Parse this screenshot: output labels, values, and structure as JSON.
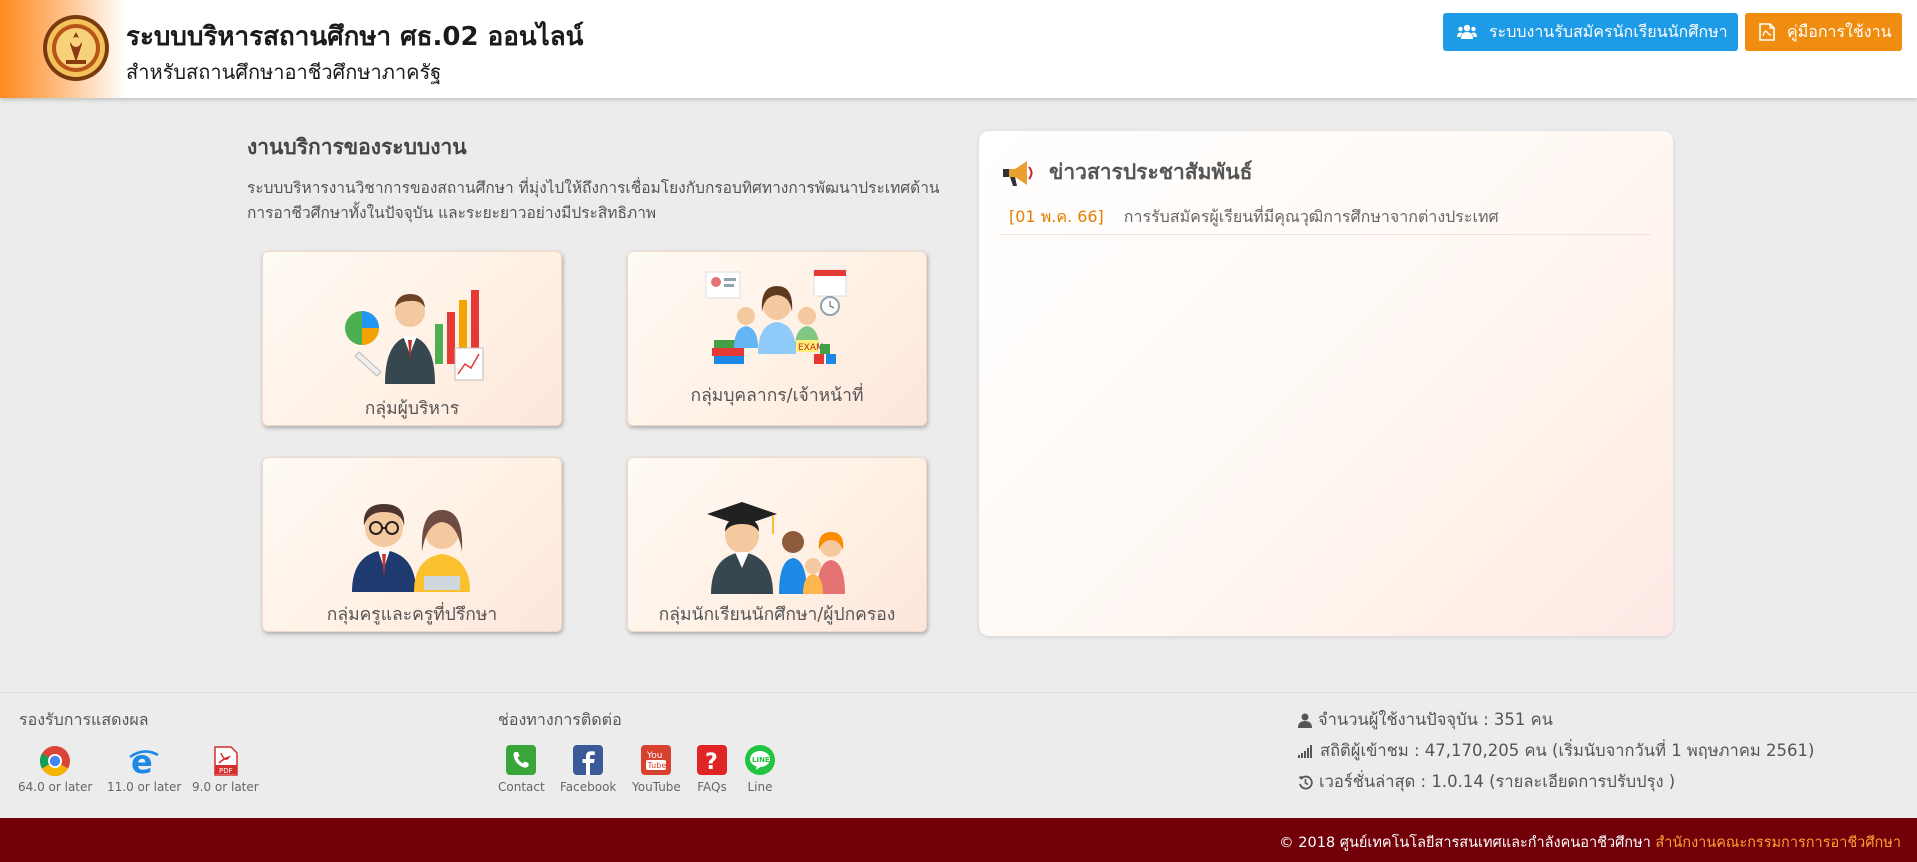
{
  "header": {
    "title": "ระบบบริหารสถานศึกษา ศธ.02 ออนไลน์",
    "subtitle": "สำหรับสถานศึกษาอาชีวศึกษาภาครัฐ",
    "btn_register": "ระบบงานรับสมัครนักเรียนนักศึกษา",
    "btn_manual": "คู่มือการใช้งาน"
  },
  "services": {
    "title": "งานบริการของระบบงาน",
    "description": "ระบบบริหารงานวิชาการของสถานศึกษา ที่มุ่งไปให้ถึงการเชื่อมโยงกับกรอบทิศทางการพัฒนาประเทศด้านการอาชีวศึกษาทั้งในปัจจุบัน และระยะยาวอย่างมีประสิทธิภาพ",
    "cards": [
      {
        "label": "กลุ่มผู้บริหาร"
      },
      {
        "label": "กลุ่มบุคลากร/เจ้าหน้าที่"
      },
      {
        "label": "กลุ่มครูและครูที่ปรึกษา"
      },
      {
        "label": "กลุ่มนักเรียนนักศึกษา/ผู้ปกครอง"
      }
    ]
  },
  "news": {
    "title": "ข่าวสารประชาสัมพันธ์",
    "items": [
      {
        "date": "[01 พ.ค. 66]",
        "text": "การรับสมัครผู้เรียนที่มีคุณวุฒิการศึกษาจากต่างประเทศ"
      }
    ]
  },
  "footer": {
    "browsers_label": "รองรับการแสดงผล",
    "browsers": [
      {
        "icon": "chrome-icon",
        "version": "64.0 or later"
      },
      {
        "icon": "ie-icon",
        "version": "11.0 or later"
      },
      {
        "icon": "pdf-icon",
        "version": "9.0 or later"
      }
    ],
    "contact_label": "ช่องทางการติดต่อ",
    "contacts": [
      {
        "icon": "phone-icon",
        "label": "Contact",
        "color": "#3aa53a"
      },
      {
        "icon": "facebook-icon",
        "label": "Facebook",
        "color": "#3b5998"
      },
      {
        "icon": "youtube-icon",
        "label": "YouTube",
        "color": "#d8402f"
      },
      {
        "icon": "faq-icon",
        "label": "FAQs",
        "color": "#e02424"
      },
      {
        "icon": "line-icon",
        "label": "Line",
        "color": "#23c342"
      }
    ],
    "stats": {
      "online": "จำนวนผู้ใช้งานปัจจุบัน : 351 คน",
      "visits": "สถิติผู้เข้าชม : 47,170,205 คน (เริ่มนับจากวันที่ 1 พฤษภาคม 2561)",
      "version": "เวอร์ชั่นล่าสุด : 1.0.14 (รายละเอียดการปรับปรุง )"
    },
    "copyright": "© 2018 ศูนย์เทคโนโลยีสารสนเทศและกำลังคนอาชีวศึกษา",
    "org": "สำนักงานคณะกรรมการการอาชีวศึกษา"
  },
  "colors": {
    "accent_blue": "#1e9be6",
    "accent_orange": "#f08c0f",
    "footer_bar": "#710008",
    "news_date": "#e67e00"
  }
}
